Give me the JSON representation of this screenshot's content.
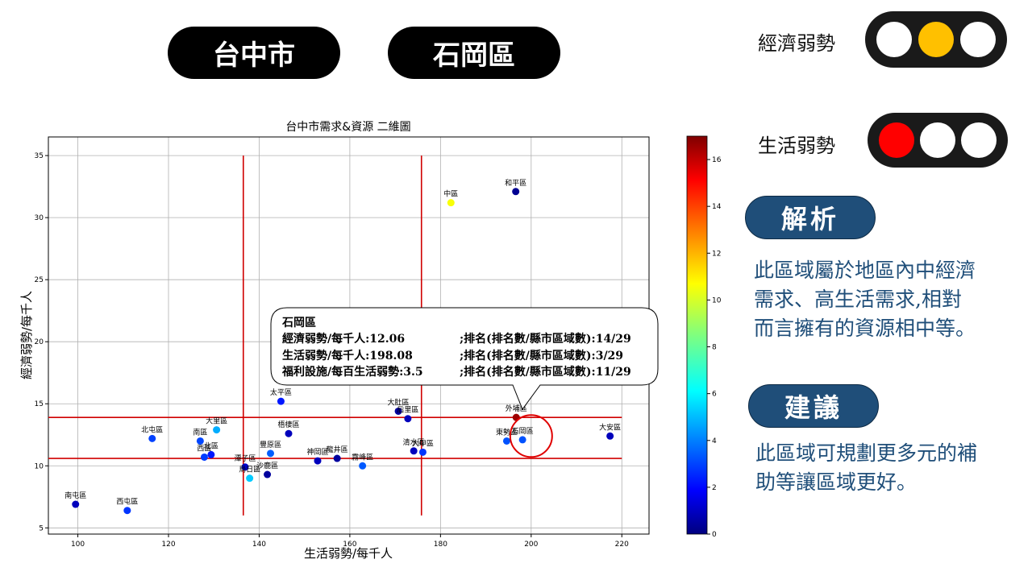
{
  "header": {
    "city": "台中市",
    "district": "石岡區"
  },
  "indicators": [
    {
      "label": "經濟弱勢",
      "lamps": [
        "#ffffff",
        "#ffc000",
        "#ffffff"
      ]
    },
    {
      "label": "生活弱勢",
      "lamps": [
        "#ff0000",
        "#ffffff",
        "#ffffff"
      ]
    }
  ],
  "analysis": {
    "title": "解析",
    "lines": [
      "此區域屬於地區內中經濟",
      "需求、高生活需求,相對",
      "而言擁有的資源相中等。"
    ]
  },
  "suggestion": {
    "title": "建議",
    "lines": [
      "此區域可規劃更多元的補",
      "助等讓區域更好。"
    ]
  },
  "callout": {
    "name": "石岡區",
    "rows": [
      {
        "metric": "經濟弱勢/每千人:12.06",
        "rank": ";排名(排名數/縣市區域數):14/29"
      },
      {
        "metric": "生活弱勢/每千人:198.08",
        "rank": ";排名(排名數/縣市區域數):3/29"
      },
      {
        "metric": "福利設施/每百生活弱勢:3.5",
        "rank": ";排名(排名數/縣市區域數):11/29"
      }
    ]
  },
  "chart_data": {
    "type": "scatter",
    "title": "台中市需求&資源 二維圖",
    "xlabel": "生活弱勢/每千人",
    "ylabel": "經濟弱勢/每千人",
    "xlim": [
      93.5,
      226
    ],
    "ylim": [
      4.5,
      36.5
    ],
    "xticks": [
      100,
      120,
      140,
      160,
      180,
      200,
      220
    ],
    "yticks": [
      5,
      10,
      15,
      20,
      25,
      30,
      35
    ],
    "colorbar": {
      "range": [
        0,
        17
      ],
      "ticks": [
        0,
        2,
        4,
        6,
        8,
        10,
        12,
        14,
        16
      ]
    },
    "reference_lines": {
      "x": [
        136.5,
        175.8
      ],
      "y": [
        10.6,
        13.9
      ]
    },
    "highlight": {
      "x": 200,
      "y": 12.4
    },
    "points": [
      {
        "name": "南屯區",
        "x": 99.5,
        "y": 6.9,
        "c": 1.0
      },
      {
        "name": "西屯區",
        "x": 110.9,
        "y": 6.4,
        "c": 3.0
      },
      {
        "name": "北屯區",
        "x": 116.4,
        "y": 12.2,
        "c": 3.2
      },
      {
        "name": "南區",
        "x": 127,
        "y": 12.0,
        "c": 3.3
      },
      {
        "name": "大里區",
        "x": 130.6,
        "y": 12.9,
        "c": 5.0
      },
      {
        "name": "北區",
        "x": 129.4,
        "y": 10.9,
        "c": 2.5
      },
      {
        "name": "西區",
        "x": 127.9,
        "y": 10.7,
        "c": 3.1
      },
      {
        "name": "潭子區",
        "x": 136.9,
        "y": 9.9,
        "c": 1.2
      },
      {
        "name": "烏日區",
        "x": 137.9,
        "y": 9.0,
        "c": 5.5
      },
      {
        "name": "沙鹿區",
        "x": 141.8,
        "y": 9.3,
        "c": 0.5
      },
      {
        "name": "豐原區",
        "x": 142.5,
        "y": 11.0,
        "c": 3.7
      },
      {
        "name": "太平區",
        "x": 144.8,
        "y": 15.2,
        "c": 2.5
      },
      {
        "name": "梧棲區",
        "x": 146.5,
        "y": 12.6,
        "c": 1.0
      },
      {
        "name": "神岡區",
        "x": 152.9,
        "y": 10.4,
        "c": 1.0
      },
      {
        "name": "龍井區",
        "x": 157.2,
        "y": 10.6,
        "c": 0.5
      },
      {
        "name": "霧峰區",
        "x": 162.8,
        "y": 10.0,
        "c": 3.6
      },
      {
        "name": "大肚區",
        "x": 170.7,
        "y": 14.4,
        "c": 0.5
      },
      {
        "name": "后里區",
        "x": 172.8,
        "y": 13.8,
        "c": 1.0
      },
      {
        "name": "清水區",
        "x": 174.1,
        "y": 11.2,
        "c": 1.0
      },
      {
        "name": "大甲區",
        "x": 176.1,
        "y": 11.1,
        "c": 3.0
      },
      {
        "name": "中區",
        "x": 182.3,
        "y": 31.2,
        "c": 10.5
      },
      {
        "name": "和平區",
        "x": 196.6,
        "y": 32.1,
        "c": 0.3
      },
      {
        "name": "外埔區",
        "x": 196.7,
        "y": 13.9,
        "c": 16.5
      },
      {
        "name": "東勢區",
        "x": 194.6,
        "y": 12.0,
        "c": 3.5
      },
      {
        "name": "石岡區",
        "x": 198.1,
        "y": 12.1,
        "c": 3.5
      },
      {
        "name": "大安區",
        "x": 217.4,
        "y": 12.4,
        "c": 1.0
      }
    ]
  }
}
